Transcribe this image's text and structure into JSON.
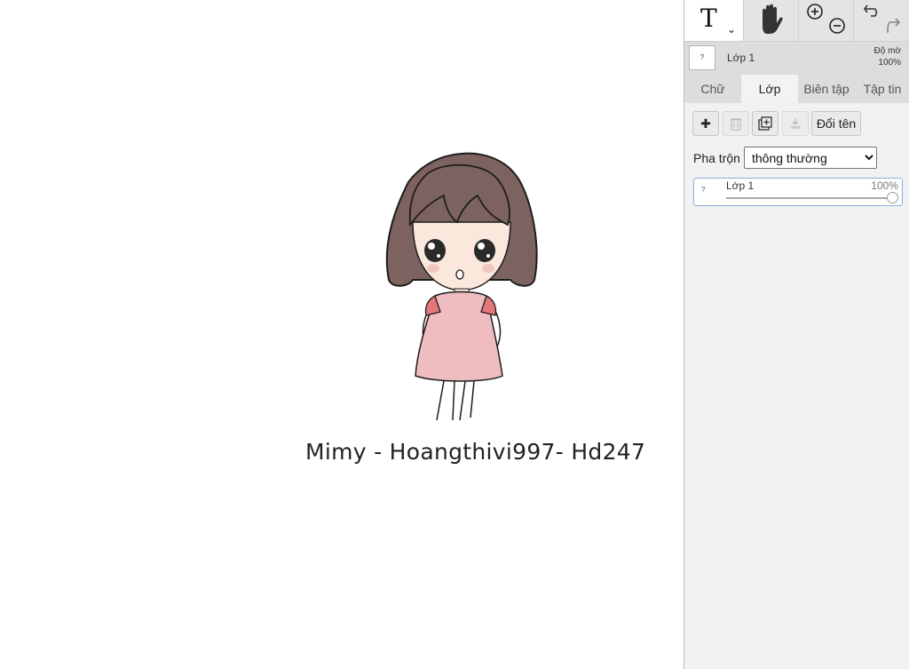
{
  "canvas": {
    "caption": "Mimy - Hoangthivi997- Hd247"
  },
  "toolbar": {
    "text_tool_label": "T",
    "text_tool_icon": "chevron-down-icon",
    "hand_tool_icon": "hand-icon",
    "zoom_in_icon": "zoom-in-icon",
    "zoom_out_icon": "zoom-out-icon",
    "undo_icon": "undo-icon",
    "redo_icon": "redo-icon"
  },
  "layer_info": {
    "thumb": "?",
    "name": "Lớp 1",
    "opacity_label": "Độ mờ",
    "opacity_value": "100%"
  },
  "tabs": [
    {
      "label": "Chữ",
      "active": false
    },
    {
      "label": "Lớp",
      "active": true
    },
    {
      "label": "Biên tập",
      "active": false
    },
    {
      "label": "Tập tin",
      "active": false
    }
  ],
  "layer_tools": {
    "add_label": "✚",
    "rename_label": "Đổi tên"
  },
  "blend": {
    "label": "Pha trộn",
    "selected": "thông thường"
  },
  "layers": [
    {
      "thumb": "?",
      "name": "Lớp 1",
      "opacity": "100%",
      "opacity_fraction": 1.0
    }
  ],
  "colors": {
    "panel_bg": "#dddddd",
    "active_tab_bg": "#f3f3f3",
    "selection_border": "#8aaee0"
  }
}
